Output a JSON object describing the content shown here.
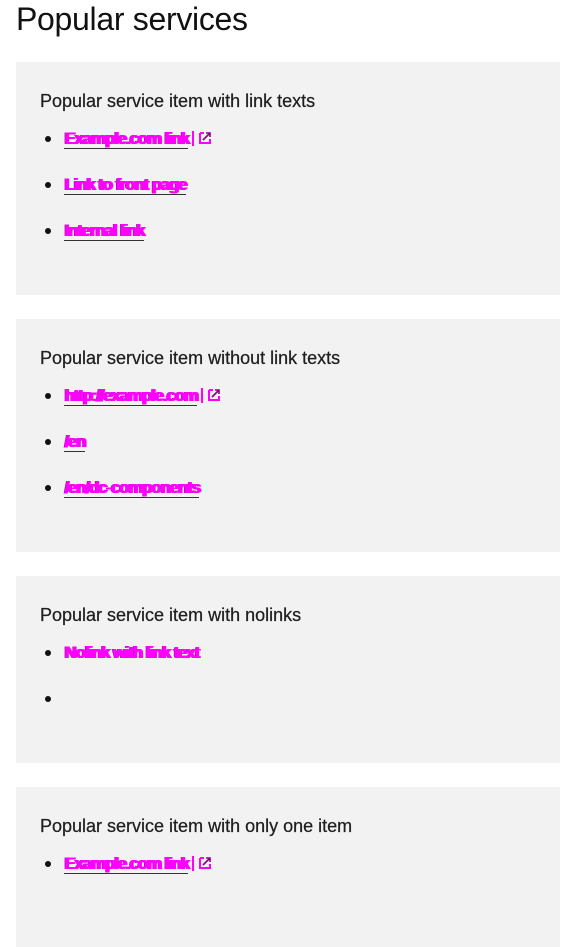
{
  "page": {
    "title": "Popular services"
  },
  "cards": [
    {
      "title": "Popular service item with link texts",
      "items": [
        {
          "label": "Example.com link",
          "type": "link",
          "external": true
        },
        {
          "label": "Link to front page",
          "type": "link",
          "external": false
        },
        {
          "label": "Internal link",
          "type": "link",
          "external": false
        }
      ]
    },
    {
      "title": "Popular service item without link texts",
      "items": [
        {
          "label": "http://example.com",
          "type": "link",
          "external": true
        },
        {
          "label": "/en",
          "type": "link",
          "external": false
        },
        {
          "label": "/en/dc-components",
          "type": "link",
          "external": false
        }
      ]
    },
    {
      "title": "Popular service item with nolinks",
      "items": [
        {
          "label": "Nolink with link text",
          "type": "text",
          "external": false
        },
        {
          "label": "",
          "type": "empty",
          "external": false
        }
      ]
    },
    {
      "title": "Popular service item with only one item",
      "items": [
        {
          "label": "Example.com link",
          "type": "link",
          "external": true
        }
      ]
    }
  ],
  "colors": {
    "link": "#ff00ff",
    "card_background": "#f2f2f2",
    "text": "#1f1f1f"
  },
  "icons": {
    "external": "external-link-icon",
    "bullet": "bullet-icon"
  }
}
